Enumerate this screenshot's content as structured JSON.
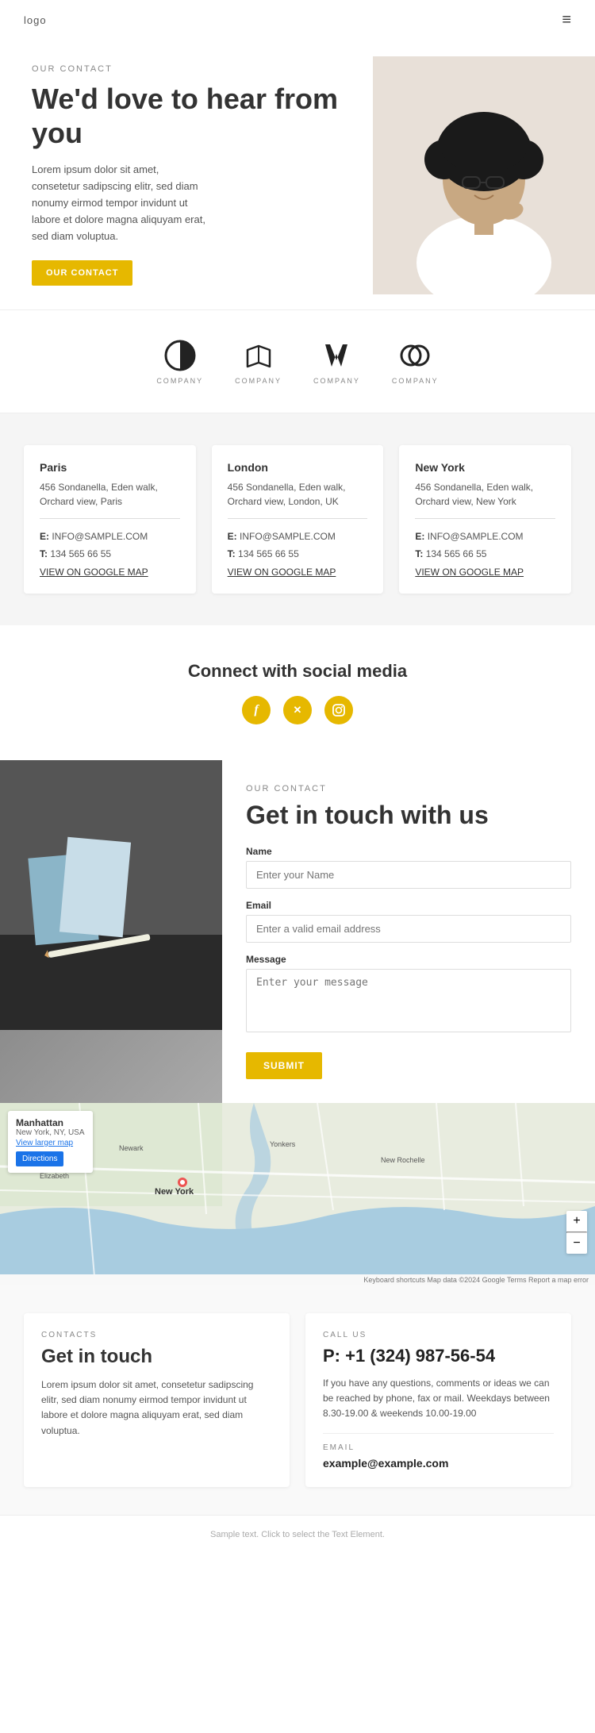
{
  "header": {
    "logo": "logo",
    "menu_icon": "≡"
  },
  "hero": {
    "label": "OUR CONTACT",
    "title": "We'd love to hear from you",
    "description": "Lorem ipsum dolor sit amet, consetetur sadipscing elitr, sed diam nonumy eirmod tempor invidunt ut labore et dolore magna aliquyam erat, sed diam voluptua.",
    "button_label": "OUR CONTACT"
  },
  "logos": [
    {
      "name": "COMPANY"
    },
    {
      "name": "COMPANY"
    },
    {
      "name": "COMPANY"
    },
    {
      "name": "COMPANY"
    }
  ],
  "offices": [
    {
      "city": "Paris",
      "address": "456 Sondanella, Eden walk, Orchard view, Paris",
      "email_label": "E:",
      "email": "INFO@SAMPLE.COM",
      "phone_label": "T:",
      "phone": "134 565 66 55",
      "map_link": "VIEW ON GOOGLE MAP"
    },
    {
      "city": "London",
      "address": "456 Sondanella, Eden walk, Orchard view, London, UK",
      "email_label": "E:",
      "email": "INFO@SAMPLE.COM",
      "phone_label": "T:",
      "phone": "134 565 66 55",
      "map_link": "VIEW ON GOOGLE MAP"
    },
    {
      "city": "New York",
      "address": "456 Sondanella, Eden walk, Orchard view, New York",
      "email_label": "E:",
      "email": "INFO@SAMPLE.COM",
      "phone_label": "T:",
      "phone": "134 565 66 55",
      "map_link": "VIEW ON GOOGLE MAP"
    }
  ],
  "social": {
    "title": "Connect with social media",
    "icons": [
      "f",
      "𝕏",
      "📷"
    ]
  },
  "contact_form": {
    "label": "OUR CONTACT",
    "title": "Get in touch with us",
    "name_label": "Name",
    "name_placeholder": "Enter your Name",
    "email_label": "Email",
    "email_placeholder": "Enter a valid email address",
    "message_label": "Message",
    "message_placeholder": "Enter your message",
    "submit_label": "SUBMIT"
  },
  "map": {
    "location": "Manhattan",
    "sub_location": "New York, NY, USA",
    "view_link": "View larger map",
    "directions_btn": "Directions",
    "zoom_in": "+",
    "zoom_out": "−",
    "footer_text": "Keyboard shortcuts  Map data ©2024 Google  Terms  Report a map error"
  },
  "bottom_contacts": {
    "card1": {
      "label": "CONTACTS",
      "title": "Get in touch",
      "description": "Lorem ipsum dolor sit amet, consetetur sadipscing elitr, sed diam nonumy eirmod tempor invidunt ut labore et dolore magna aliquyam erat, sed diam voluptua."
    },
    "card2": {
      "label": "CALL US",
      "number": "P: +1 (324) 987-56-54",
      "description": "If you have any questions, comments or ideas we can be reached by phone, fax or mail. Weekdays between 8.30-19.00 & weekends 10.00-19.00",
      "email_label": "EMAIL",
      "email": "example@example.com"
    }
  },
  "footer": {
    "text": "Sample text. Click to select the Text Element."
  }
}
